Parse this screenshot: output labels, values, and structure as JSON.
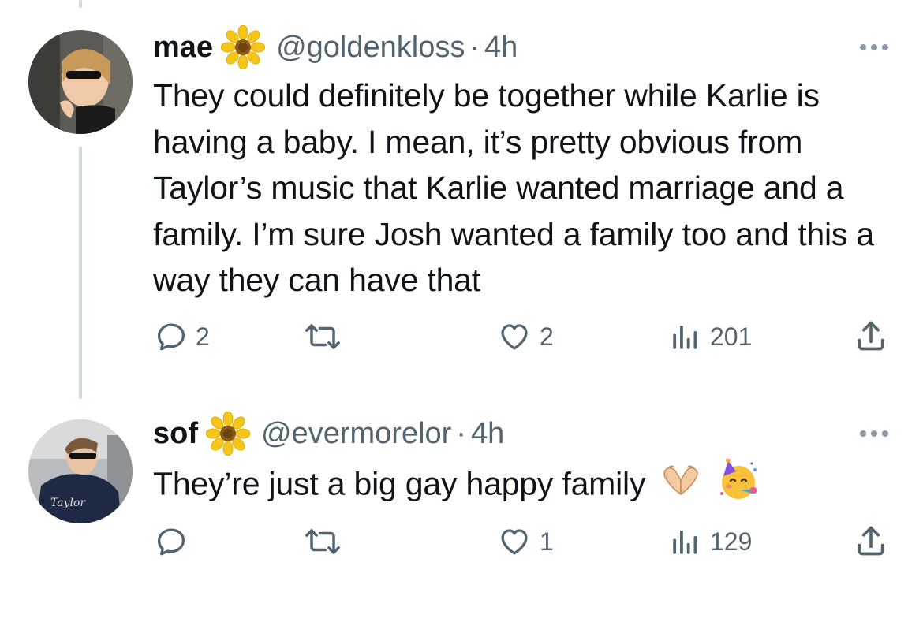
{
  "tweets": [
    {
      "display_name": "mae",
      "badge_icon": "sunflower-icon",
      "handle": "@goldenkloss",
      "separator": "·",
      "time": "4h",
      "text": "They could definitely be together while Karlie is having a baby. I mean, it’s pretty obvious from Taylor’s music that Karlie wanted marriage and a family. I’m sure Josh wanted a family too and this a way they can have that",
      "actions": {
        "replies": "2",
        "reposts": "",
        "likes": "2",
        "views": "201"
      }
    },
    {
      "display_name": "sof",
      "badge_icon": "sunflower-icon",
      "handle": "@evermorelor",
      "separator": "·",
      "time": "4h",
      "text": "They’re just a big gay happy family",
      "emojis": [
        "heart-hands-icon",
        "partying-face-icon"
      ],
      "actions": {
        "replies": "",
        "reposts": "",
        "likes": "1",
        "views": "129"
      }
    }
  ],
  "colors": {
    "text": "#0f1419",
    "secondary": "#536471",
    "thread_line": "#cfd9de",
    "flower_petal": "#f5c518",
    "flower_center": "#8a5a12"
  }
}
